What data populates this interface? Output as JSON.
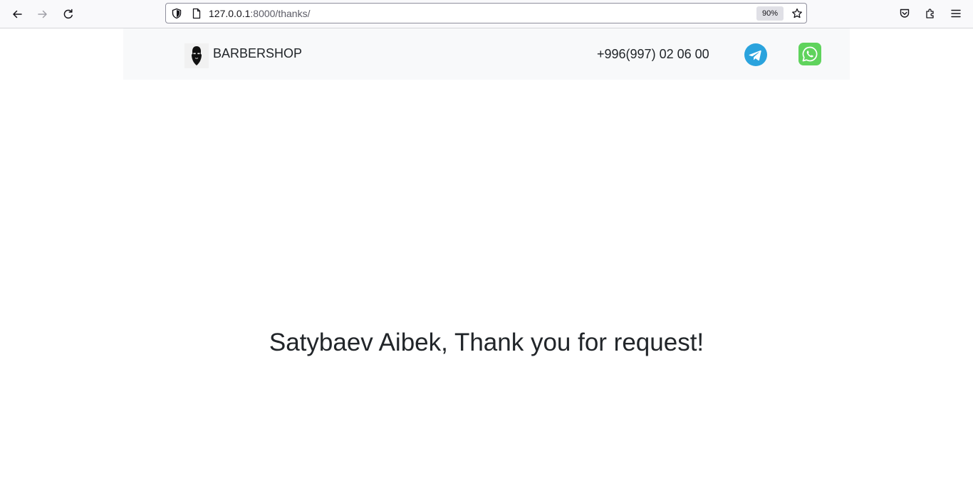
{
  "browser": {
    "url_host": "127.0.0.1",
    "url_rest": ":8000/thanks/",
    "zoom": "90%"
  },
  "header": {
    "brand": "BARBERSHOP",
    "phone": "+996(997) 02 06 00"
  },
  "main": {
    "message": "Satybaev Aibek, Thank you for request!"
  },
  "colors": {
    "header_bg": "#f8f9fa",
    "text": "#212529",
    "telegram": "#2aa3dd",
    "whatsapp": "#5fd35c"
  },
  "icons": {
    "back": "back-arrow-icon",
    "forward": "forward-arrow-icon",
    "reload": "reload-icon",
    "shield": "shield-icon",
    "page": "page-icon",
    "star": "star-icon",
    "pocket": "pocket-icon",
    "extensions": "extensions-icon",
    "menu": "hamburger-menu-icon",
    "logo": "bearded-man-logo-icon",
    "telegram": "telegram-icon",
    "whatsapp": "whatsapp-icon"
  }
}
